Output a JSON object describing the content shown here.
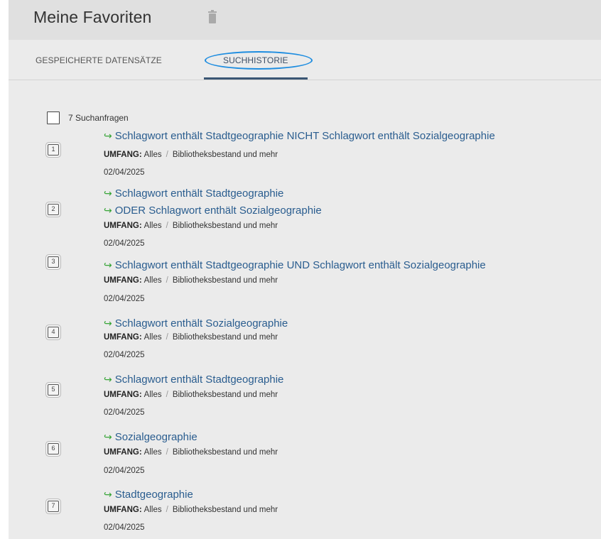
{
  "header": {
    "title": "Meine Favoriten"
  },
  "tabs": [
    {
      "label": "GESPEICHERTE DATENSÄTZE"
    },
    {
      "label": "SUCHHISTORIE"
    }
  ],
  "history": {
    "count_label": "7 Suchanfragen",
    "scope_key": "UMFANG:",
    "scope_value": "Alles",
    "scope_sep": "/",
    "scope_detail": "Bibliotheksbestand und mehr",
    "entries": [
      {
        "number": "1",
        "queries": [
          "Schlagwort enthält Stadtgeographie NICHT Schlagwort enthält Sozialgeographie"
        ],
        "date": "02/04/2025"
      },
      {
        "number": "2",
        "queries": [
          "Schlagwort enthält Stadtgeographie",
          "ODER Schlagwort enthält Sozialgeographie"
        ],
        "date": "02/04/2025"
      },
      {
        "number": "3",
        "queries": [
          "Schlagwort enthält Stadtgeographie UND Schlagwort enthält Sozialgeographie"
        ],
        "date": "02/04/2025"
      },
      {
        "number": "4",
        "queries": [
          "Schlagwort enthält Sozialgeographie"
        ],
        "date": "02/04/2025"
      },
      {
        "number": "5",
        "queries": [
          "Schlagwort enthält Stadtgeographie"
        ],
        "date": "02/04/2025"
      },
      {
        "number": "6",
        "queries": [
          "Sozialgeographie"
        ],
        "date": "02/04/2025"
      },
      {
        "number": "7",
        "queries": [
          "Stadtgeographie"
        ],
        "date": "02/04/2025"
      }
    ]
  },
  "icons": {
    "delete": "trash-icon",
    "query_arrow": "arrow-return-icon"
  },
  "colors": {
    "link": "#2a5d8f",
    "arrow": "#36a436",
    "tab_underline": "#3a5674",
    "highlight_ring": "#1e8de0"
  }
}
